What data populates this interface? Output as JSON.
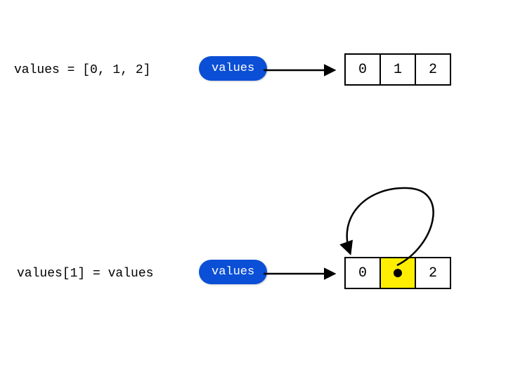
{
  "row1": {
    "code": "values = [0, 1, 2]",
    "pill": "values",
    "cells": [
      "0",
      "1",
      "2"
    ]
  },
  "row2": {
    "code": "values[1] = values",
    "pill": "values",
    "cells": [
      "0",
      "",
      "2"
    ]
  },
  "colors": {
    "pill_bg": "#0b4fd6",
    "highlight_bg": "#ffee00"
  },
  "diagram": {
    "description": "Python list self-reference: after values[1] = values, the middle cell points back to the list itself",
    "arrows": [
      {
        "from": "row1.pill",
        "to": "row1.array",
        "kind": "straight"
      },
      {
        "from": "row2.pill",
        "to": "row2.array",
        "kind": "straight"
      },
      {
        "from": "row2.cell1.dot",
        "to": "row2.array",
        "kind": "curved-self-reference"
      }
    ]
  }
}
